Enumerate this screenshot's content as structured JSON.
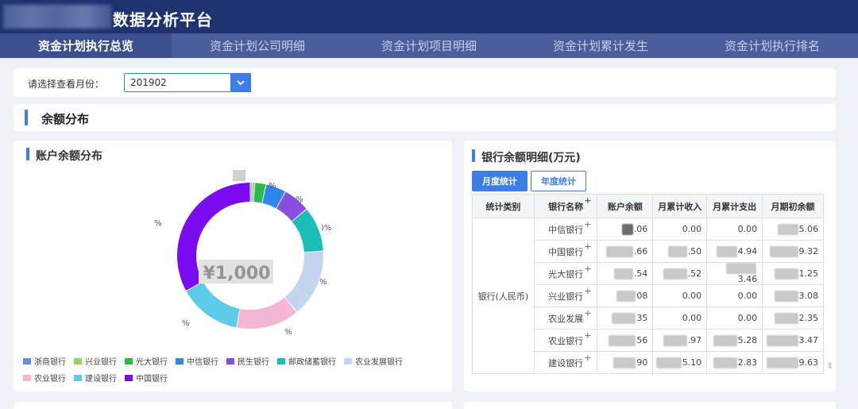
{
  "header": {
    "title": "数据分析平台"
  },
  "nav": {
    "tabs": [
      {
        "label": "资金计划执行总览",
        "active": true
      },
      {
        "label": "资金计划公司明细",
        "active": false
      },
      {
        "label": "资金计划项目明细",
        "active": false
      },
      {
        "label": "资金计划累计发生",
        "active": false
      },
      {
        "label": "资金计划执行排名",
        "active": false
      }
    ]
  },
  "filter": {
    "label": "请选择查看月份：",
    "value": "201902"
  },
  "section": {
    "title": "余额分布"
  },
  "left_panel": {
    "title": "账户余额分布",
    "center_value": "¥1,000",
    "slice_labels": [
      "%",
      "%",
      ")%",
      "%",
      "%",
      "%",
      "%"
    ],
    "legend": [
      {
        "label": "浙商银行",
        "color": "#6a8bd9"
      },
      {
        "label": "兴业银行",
        "color": "#92d36e"
      },
      {
        "label": "光大银行",
        "color": "#2db84c"
      },
      {
        "label": "中信银行",
        "color": "#2f86ee"
      },
      {
        "label": "民生银行",
        "color": "#8a4fe0"
      },
      {
        "label": "邮政储蓄银行",
        "color": "#1bbfb7"
      },
      {
        "label": "农业发展银行",
        "color": "#c4d5f0"
      },
      {
        "label": "农业银行",
        "color": "#f4b6d3"
      },
      {
        "label": "建设银行",
        "color": "#5ccbea"
      },
      {
        "label": "中国银行",
        "color": "#7a0bf0"
      }
    ]
  },
  "chart_data": {
    "type": "pie",
    "categories": [
      "浙商银行",
      "兴业银行",
      "光大银行",
      "中信银行",
      "民生银行",
      "邮政储蓄银行",
      "农业发展银行",
      "农业银行",
      "建设银行",
      "中国银行"
    ],
    "values": [
      0.4,
      0.6,
      2.5,
      4.5,
      6,
      10,
      15,
      14,
      14,
      33
    ],
    "colors": [
      "#6a8bd9",
      "#92d36e",
      "#2db84c",
      "#2f86ee",
      "#8a4fe0",
      "#1bbfb7",
      "#c4d5f0",
      "#f4b6d3",
      "#5ccbea",
      "#7a0bf0"
    ],
    "title": "账户余额分布"
  },
  "right_panel": {
    "title": "银行余额明细(万元)",
    "tabs": [
      "月度统计",
      "年度统计"
    ],
    "columns": [
      "统计类别",
      "银行名称",
      "账户余额",
      "月累计收入",
      "月累计支出",
      "月期初余额"
    ],
    "category": "银行(人民币)",
    "rows": [
      {
        "bank": "中信银行",
        "balance": ".06",
        "income": "0.00",
        "expense": "0.00",
        "opening": "5.06"
      },
      {
        "bank": "中国银行",
        "balance": ".66",
        "income": ".50",
        "expense": "4.94",
        "opening": "9.32"
      },
      {
        "bank": "光大银行",
        "balance": ".54",
        "income": ".52",
        "expense": "3.46",
        "opening": "1.25"
      },
      {
        "bank": "兴业银行",
        "balance": "08",
        "income": "0.00",
        "expense": "0.00",
        "opening": "3.08"
      },
      {
        "bank": "农业发展",
        "balance": "35",
        "income": "0.00",
        "expense": "0.00",
        "opening": "2.35"
      },
      {
        "bank": "农业银行",
        "balance": "56",
        "income": ".97",
        "expense": "5.28",
        "opening": "3.47"
      },
      {
        "bank": "建设银行",
        "balance": "90",
        "income": "5.10",
        "expense": "2.83",
        "opening": "9.63"
      }
    ]
  }
}
